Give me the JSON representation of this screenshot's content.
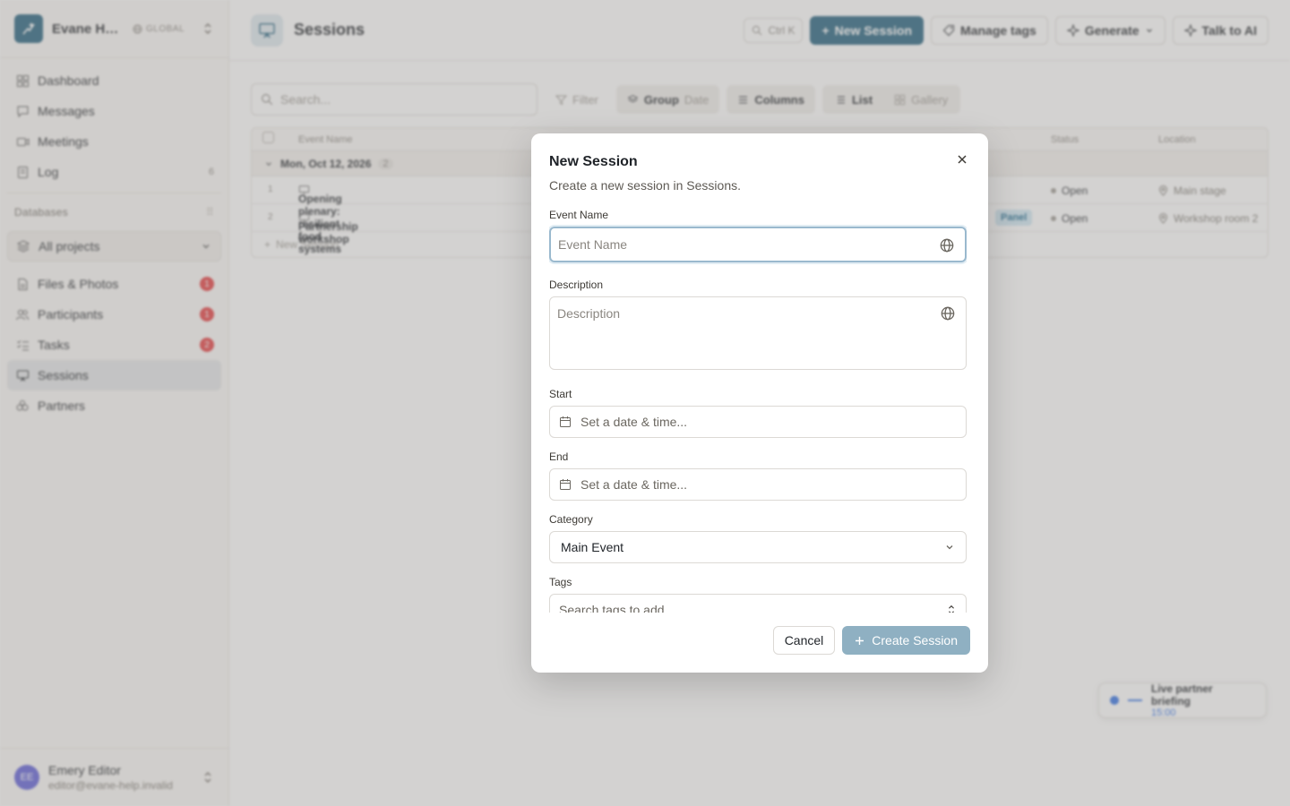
{
  "workspace": {
    "name": "Evane He...",
    "scope": "GLOBAL"
  },
  "nav": {
    "items": [
      {
        "label": "Dashboard",
        "icon": "grid-icon"
      },
      {
        "label": "Messages",
        "icon": "chat-icon"
      },
      {
        "label": "Meetings",
        "icon": "video-icon"
      },
      {
        "label": "Log",
        "icon": "log-icon",
        "count": "6"
      }
    ]
  },
  "databases": {
    "title": "Databases",
    "project_select": "All projects",
    "items": [
      {
        "label": "Files & Photos",
        "badge": "1"
      },
      {
        "label": "Participants",
        "badge": "1"
      },
      {
        "label": "Tasks",
        "badge": "2"
      },
      {
        "label": "Sessions"
      },
      {
        "label": "Partners"
      }
    ]
  },
  "user": {
    "initials": "EE",
    "name": "Emery Editor",
    "email": "editor@evane-help.invalid"
  },
  "page": {
    "title": "Sessions"
  },
  "top_actions": {
    "shortcut": "Ctrl K",
    "new_session": "New Session",
    "manage_tags": "Manage tags",
    "generate": "Generate",
    "talk_ai": "Talk to AI"
  },
  "toolbar": {
    "search_placeholder": "Search...",
    "filter": "Filter",
    "group": "Group",
    "group_value": "Date",
    "columns": "Columns",
    "list": "List",
    "gallery": "Gallery"
  },
  "table": {
    "columns": {
      "event_name": "Event Name",
      "status": "Status",
      "location": "Location"
    },
    "group": {
      "label": "Mon, Oct 12, 2026",
      "count": "2"
    },
    "rows": [
      {
        "num": "1",
        "title": "Opening plenary: resilient food systems",
        "status": "Open",
        "location": "Main stage"
      },
      {
        "num": "2",
        "title": "Partnership workshop",
        "tag": "Panel",
        "status": "Open",
        "location": "Workshop room 2"
      }
    ],
    "add_row": "New Session"
  },
  "floater": {
    "title": "Live partner briefing",
    "time": "15:00"
  },
  "modal": {
    "title": "New Session",
    "subtitle": "Create a new session in Sessions.",
    "event_name_label": "Event Name",
    "event_name_placeholder": "Event Name",
    "description_label": "Description",
    "description_placeholder": "Description",
    "start_label": "Start",
    "start_placeholder": "Set a date & time...",
    "end_label": "End",
    "end_placeholder": "Set a date & time...",
    "category_label": "Category",
    "category_value": "Main Event",
    "tags_label": "Tags",
    "tags_placeholder": "Search tags to add...",
    "cancel": "Cancel",
    "create": "Create Session"
  },
  "colors": {
    "brand": "#1d5c7a",
    "badge_red": "#e5383b",
    "create_disabled": "#8fb0c2"
  }
}
